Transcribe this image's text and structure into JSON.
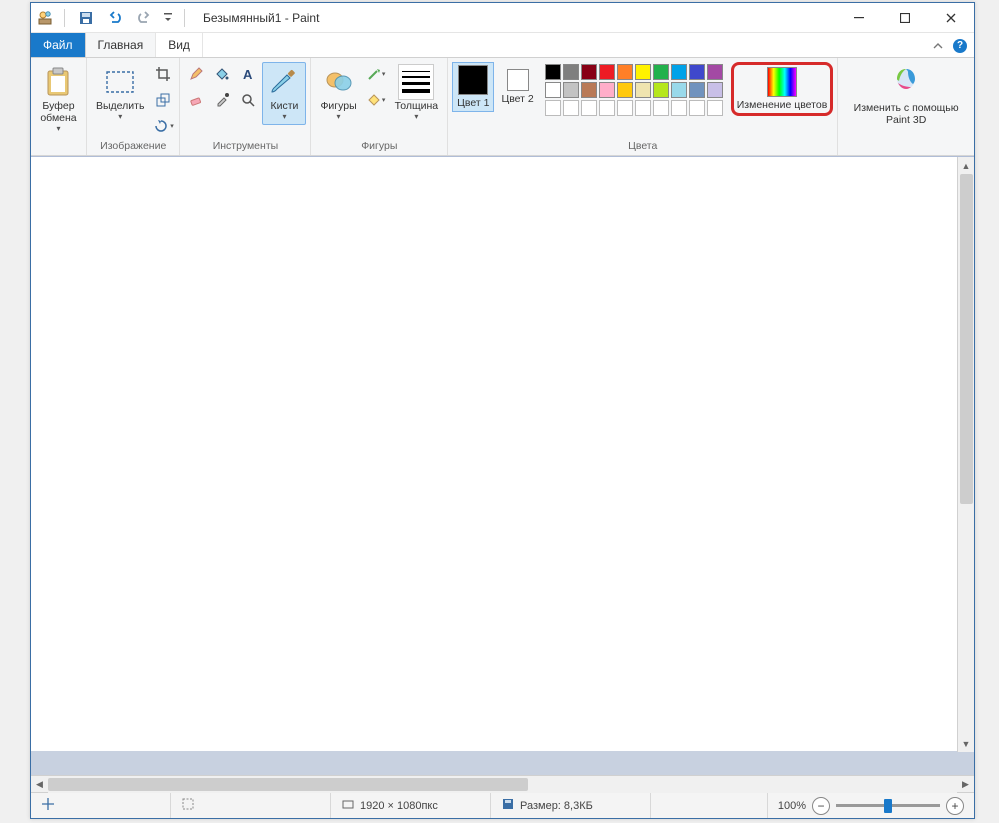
{
  "window": {
    "title": "Безымянный1 - Paint"
  },
  "tabs": {
    "file": "Файл",
    "home": "Главная",
    "view": "Вид"
  },
  "groups": {
    "clipboard": {
      "label": "",
      "paste": "Буфер\nобмена"
    },
    "image": {
      "label": "Изображение",
      "select": "Выделить"
    },
    "tools": {
      "label": "Инструменты",
      "brushes": "Кисти"
    },
    "shapes": {
      "label": "Фигуры",
      "shapes_btn": "Фигуры",
      "thickness": "Толщина"
    },
    "colors": {
      "label": "Цвета",
      "color1": "Цвет\n1",
      "color2": "Цвет\n2",
      "edit": "Изменение\nцветов",
      "row1": [
        "#000000",
        "#7f7f7f",
        "#880015",
        "#ed1c24",
        "#ff7f27",
        "#fff200",
        "#22b14c",
        "#00a2e8",
        "#3f48cc",
        "#a349a4"
      ],
      "row2": [
        "#ffffff",
        "#c3c3c3",
        "#b97a57",
        "#ffaec9",
        "#ffc90e",
        "#efe4b0",
        "#b5e61d",
        "#99d9ea",
        "#7092be",
        "#c8bfe7"
      ]
    },
    "paint3d": {
      "label": "Изменить с\nпомощью Paint 3D"
    }
  },
  "status": {
    "dimensions": "1920 × 1080пкс",
    "size_label": "Размер: 8,3КБ",
    "zoom": "100%"
  }
}
